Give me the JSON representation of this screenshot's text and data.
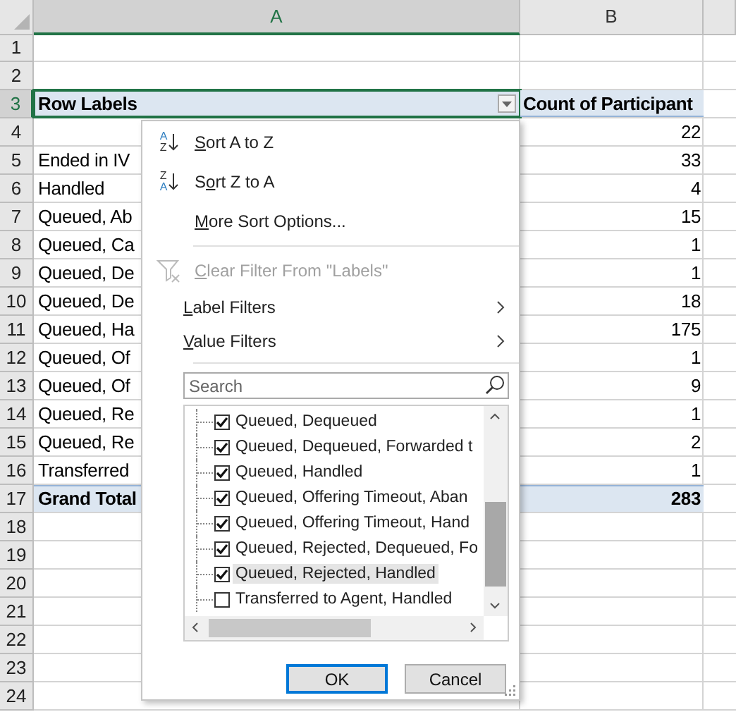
{
  "columns": [
    {
      "label": "A",
      "selected": true
    },
    {
      "label": "B",
      "selected": false
    }
  ],
  "rows": [
    {
      "number": "1",
      "kind": "blank",
      "selected": false
    },
    {
      "number": "2",
      "kind": "blank",
      "selected": false
    },
    {
      "number": "3",
      "kind": "header",
      "selected": true,
      "label": "Row Labels",
      "value": "Count of Participant"
    },
    {
      "number": "4",
      "kind": "data",
      "selected": false,
      "value": "22"
    },
    {
      "number": "5",
      "kind": "data",
      "selected": false,
      "label": "Ended in IV",
      "value": "33"
    },
    {
      "number": "6",
      "kind": "data",
      "selected": false,
      "label": "Handled",
      "value": "4"
    },
    {
      "number": "7",
      "kind": "data",
      "selected": false,
      "label": "Queued, Ab",
      "value": "15"
    },
    {
      "number": "8",
      "kind": "data",
      "selected": false,
      "label": "Queued, Ca",
      "value": "1"
    },
    {
      "number": "9",
      "kind": "data",
      "selected": false,
      "label": "Queued, De",
      "value": "1"
    },
    {
      "number": "10",
      "kind": "data",
      "selected": false,
      "label": "Queued, De",
      "value": "18"
    },
    {
      "number": "11",
      "kind": "data",
      "selected": false,
      "label": "Queued, Ha",
      "value": "175"
    },
    {
      "number": "12",
      "kind": "data",
      "selected": false,
      "label": "Queued, Of",
      "value": "1"
    },
    {
      "number": "13",
      "kind": "data",
      "selected": false,
      "label": "Queued, Of",
      "value": "9"
    },
    {
      "number": "14",
      "kind": "data",
      "selected": false,
      "label": "Queued, Re",
      "value": "1"
    },
    {
      "number": "15",
      "kind": "data",
      "selected": false,
      "label": "Queued, Re",
      "value": "2"
    },
    {
      "number": "16",
      "kind": "data",
      "selected": false,
      "label": "Transferred",
      "value": "1"
    },
    {
      "number": "17",
      "kind": "total",
      "selected": false,
      "label": "Grand Total",
      "value": "283"
    },
    {
      "number": "18",
      "kind": "blank",
      "selected": false
    },
    {
      "number": "19",
      "kind": "blank",
      "selected": false
    },
    {
      "number": "20",
      "kind": "blank",
      "selected": false
    },
    {
      "number": "21",
      "kind": "blank",
      "selected": false
    },
    {
      "number": "22",
      "kind": "blank",
      "selected": false
    },
    {
      "number": "23",
      "kind": "blank",
      "selected": false
    },
    {
      "number": "24",
      "kind": "blank",
      "selected": false
    }
  ],
  "filter_menu": {
    "items": [
      {
        "kind": "sort-asc",
        "disabled": false,
        "icon_top": "A",
        "icon_bottom": "Z",
        "key": "S",
        "post": "ort A to Z"
      },
      {
        "kind": "sort-desc",
        "disabled": false,
        "icon_top": "Z",
        "icon_bottom": "A",
        "pre": "S",
        "key": "o",
        "post": "rt Z to A"
      },
      {
        "kind": "command",
        "disabled": false,
        "key": "M",
        "post": "ore Sort Options..."
      },
      {
        "kind": "separator"
      },
      {
        "kind": "clear",
        "disabled": true,
        "key": "C",
        "post": "lear Filter From \"Labels\""
      },
      {
        "kind": "submenu",
        "disabled": false,
        "key": "L",
        "post": "abel Filters"
      },
      {
        "kind": "submenu",
        "disabled": false,
        "key": "V",
        "post": "alue Filters"
      },
      {
        "kind": "separator"
      }
    ],
    "search": {
      "placeholder": "Search"
    },
    "list": [
      {
        "label": "Queued, Dequeued",
        "checked": true,
        "selected": false
      },
      {
        "label": "Queued, Dequeued, Forwarded t",
        "checked": true,
        "selected": false
      },
      {
        "label": "Queued, Handled",
        "checked": true,
        "selected": false
      },
      {
        "label": "Queued, Offering Timeout, Aban",
        "checked": true,
        "selected": false
      },
      {
        "label": "Queued, Offering Timeout, Hand",
        "checked": true,
        "selected": false
      },
      {
        "label": "Queued, Rejected, Dequeued, Fo",
        "checked": true,
        "selected": false
      },
      {
        "label": "Queued, Rejected, Handled",
        "checked": true,
        "selected": true
      },
      {
        "label": "Transferred to Agent, Handled",
        "checked": false,
        "selected": false
      }
    ],
    "buttons": [
      {
        "label": "OK",
        "default": true
      },
      {
        "label": "Cancel",
        "default": false
      }
    ]
  }
}
